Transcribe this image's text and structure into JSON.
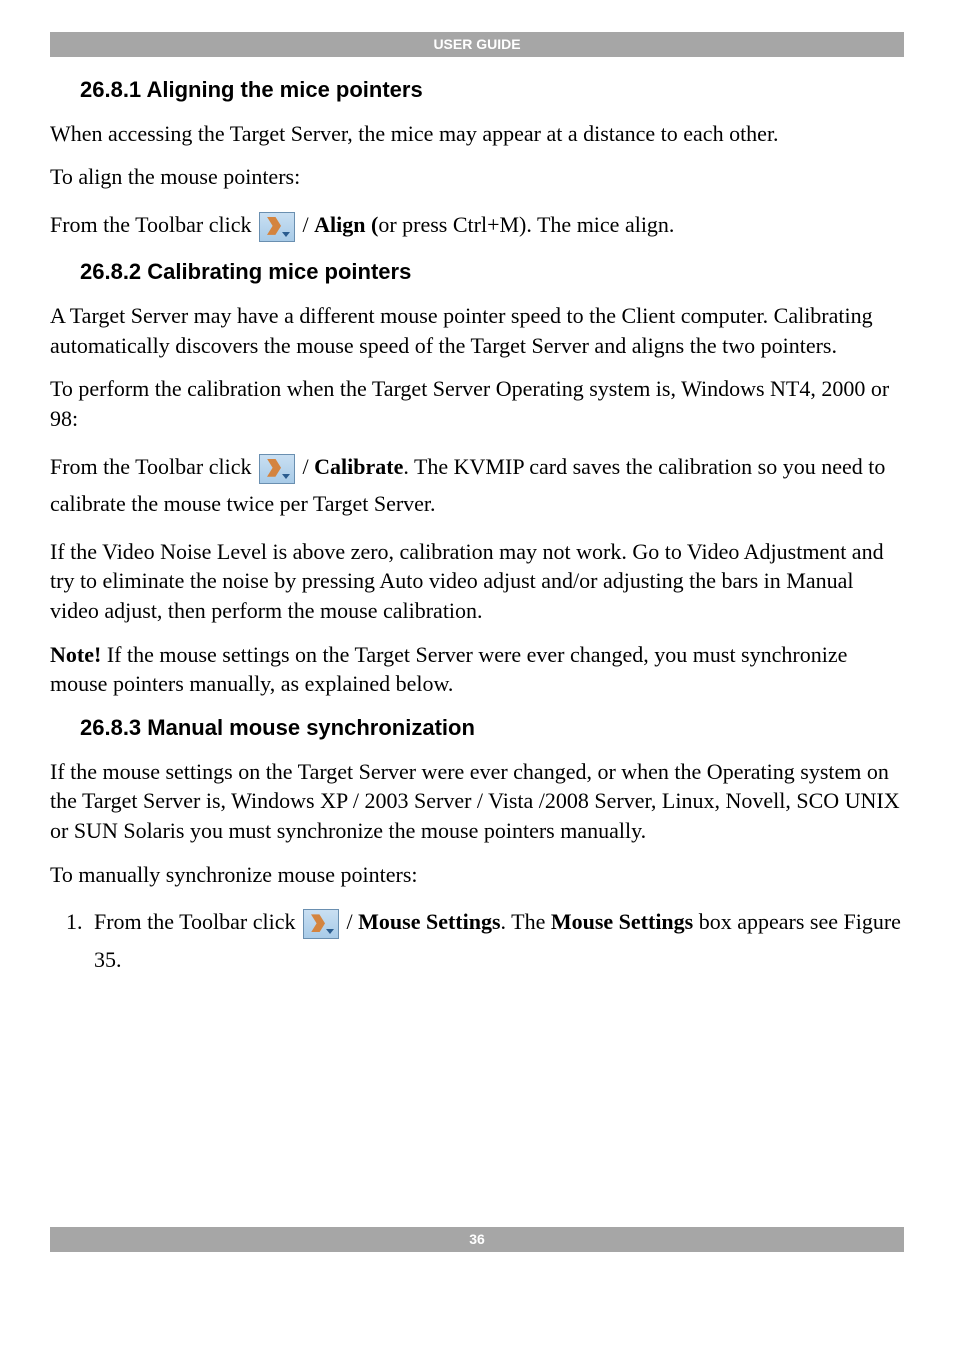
{
  "header": {
    "title": "USER GUIDE"
  },
  "footer": {
    "page": "36"
  },
  "sections": {
    "s1": {
      "heading": "26.8.1 Aligning the mice pointers",
      "p1": "When accessing the Target Server, the mice may appear at a distance to each other.",
      "p2": "To align the mouse pointers:",
      "p3a": "From the Toolbar click ",
      "p3b": " / ",
      "p3c": "Align (",
      "p3d": "or press Ctrl+M). The mice align."
    },
    "s2": {
      "heading": "26.8.2 Calibrating mice pointers",
      "p1": "A Target Server may have a different mouse pointer speed to the Client computer. Calibrating automatically discovers the mouse speed of the Target Server and aligns the two pointers.",
      "p2": "To perform the calibration when the Target Server Operating system is, Windows NT4, 2000 or 98:",
      "p3a": "From the Toolbar click ",
      "p3b": " / ",
      "p3c": "Calibrate",
      "p3d": ". The KVMIP card saves the calibration so you need to calibrate the mouse twice per Target Server.",
      "p4": "If the Video Noise Level is above zero, calibration may not work. Go to Video Adjustment and try to eliminate the noise by pressing Auto video adjust and/or adjusting the bars in Manual video adjust, then perform the mouse calibration.",
      "p5a": "Note!",
      "p5b": " If the mouse settings on the Target Server were ever changed, you must synchronize mouse pointers manually, as explained below."
    },
    "s3": {
      "heading": "26.8.3 Manual mouse synchronization",
      "p1": "If the mouse settings on the Target Server were ever changed, or when the Operating system on the Target Server is, Windows XP / 2003 Server / Vista /2008 Server, Linux, Novell, SCO UNIX or SUN Solaris you must synchronize the mouse pointers manually.",
      "p2": "To manually synchronize mouse pointers:",
      "li1a": "From the Toolbar click ",
      "li1b": " / ",
      "li1c": "Mouse Settings",
      "li1d": ". The ",
      "li1e": "Mouse Settings",
      "li1f": " box appears see Figure 35."
    }
  }
}
